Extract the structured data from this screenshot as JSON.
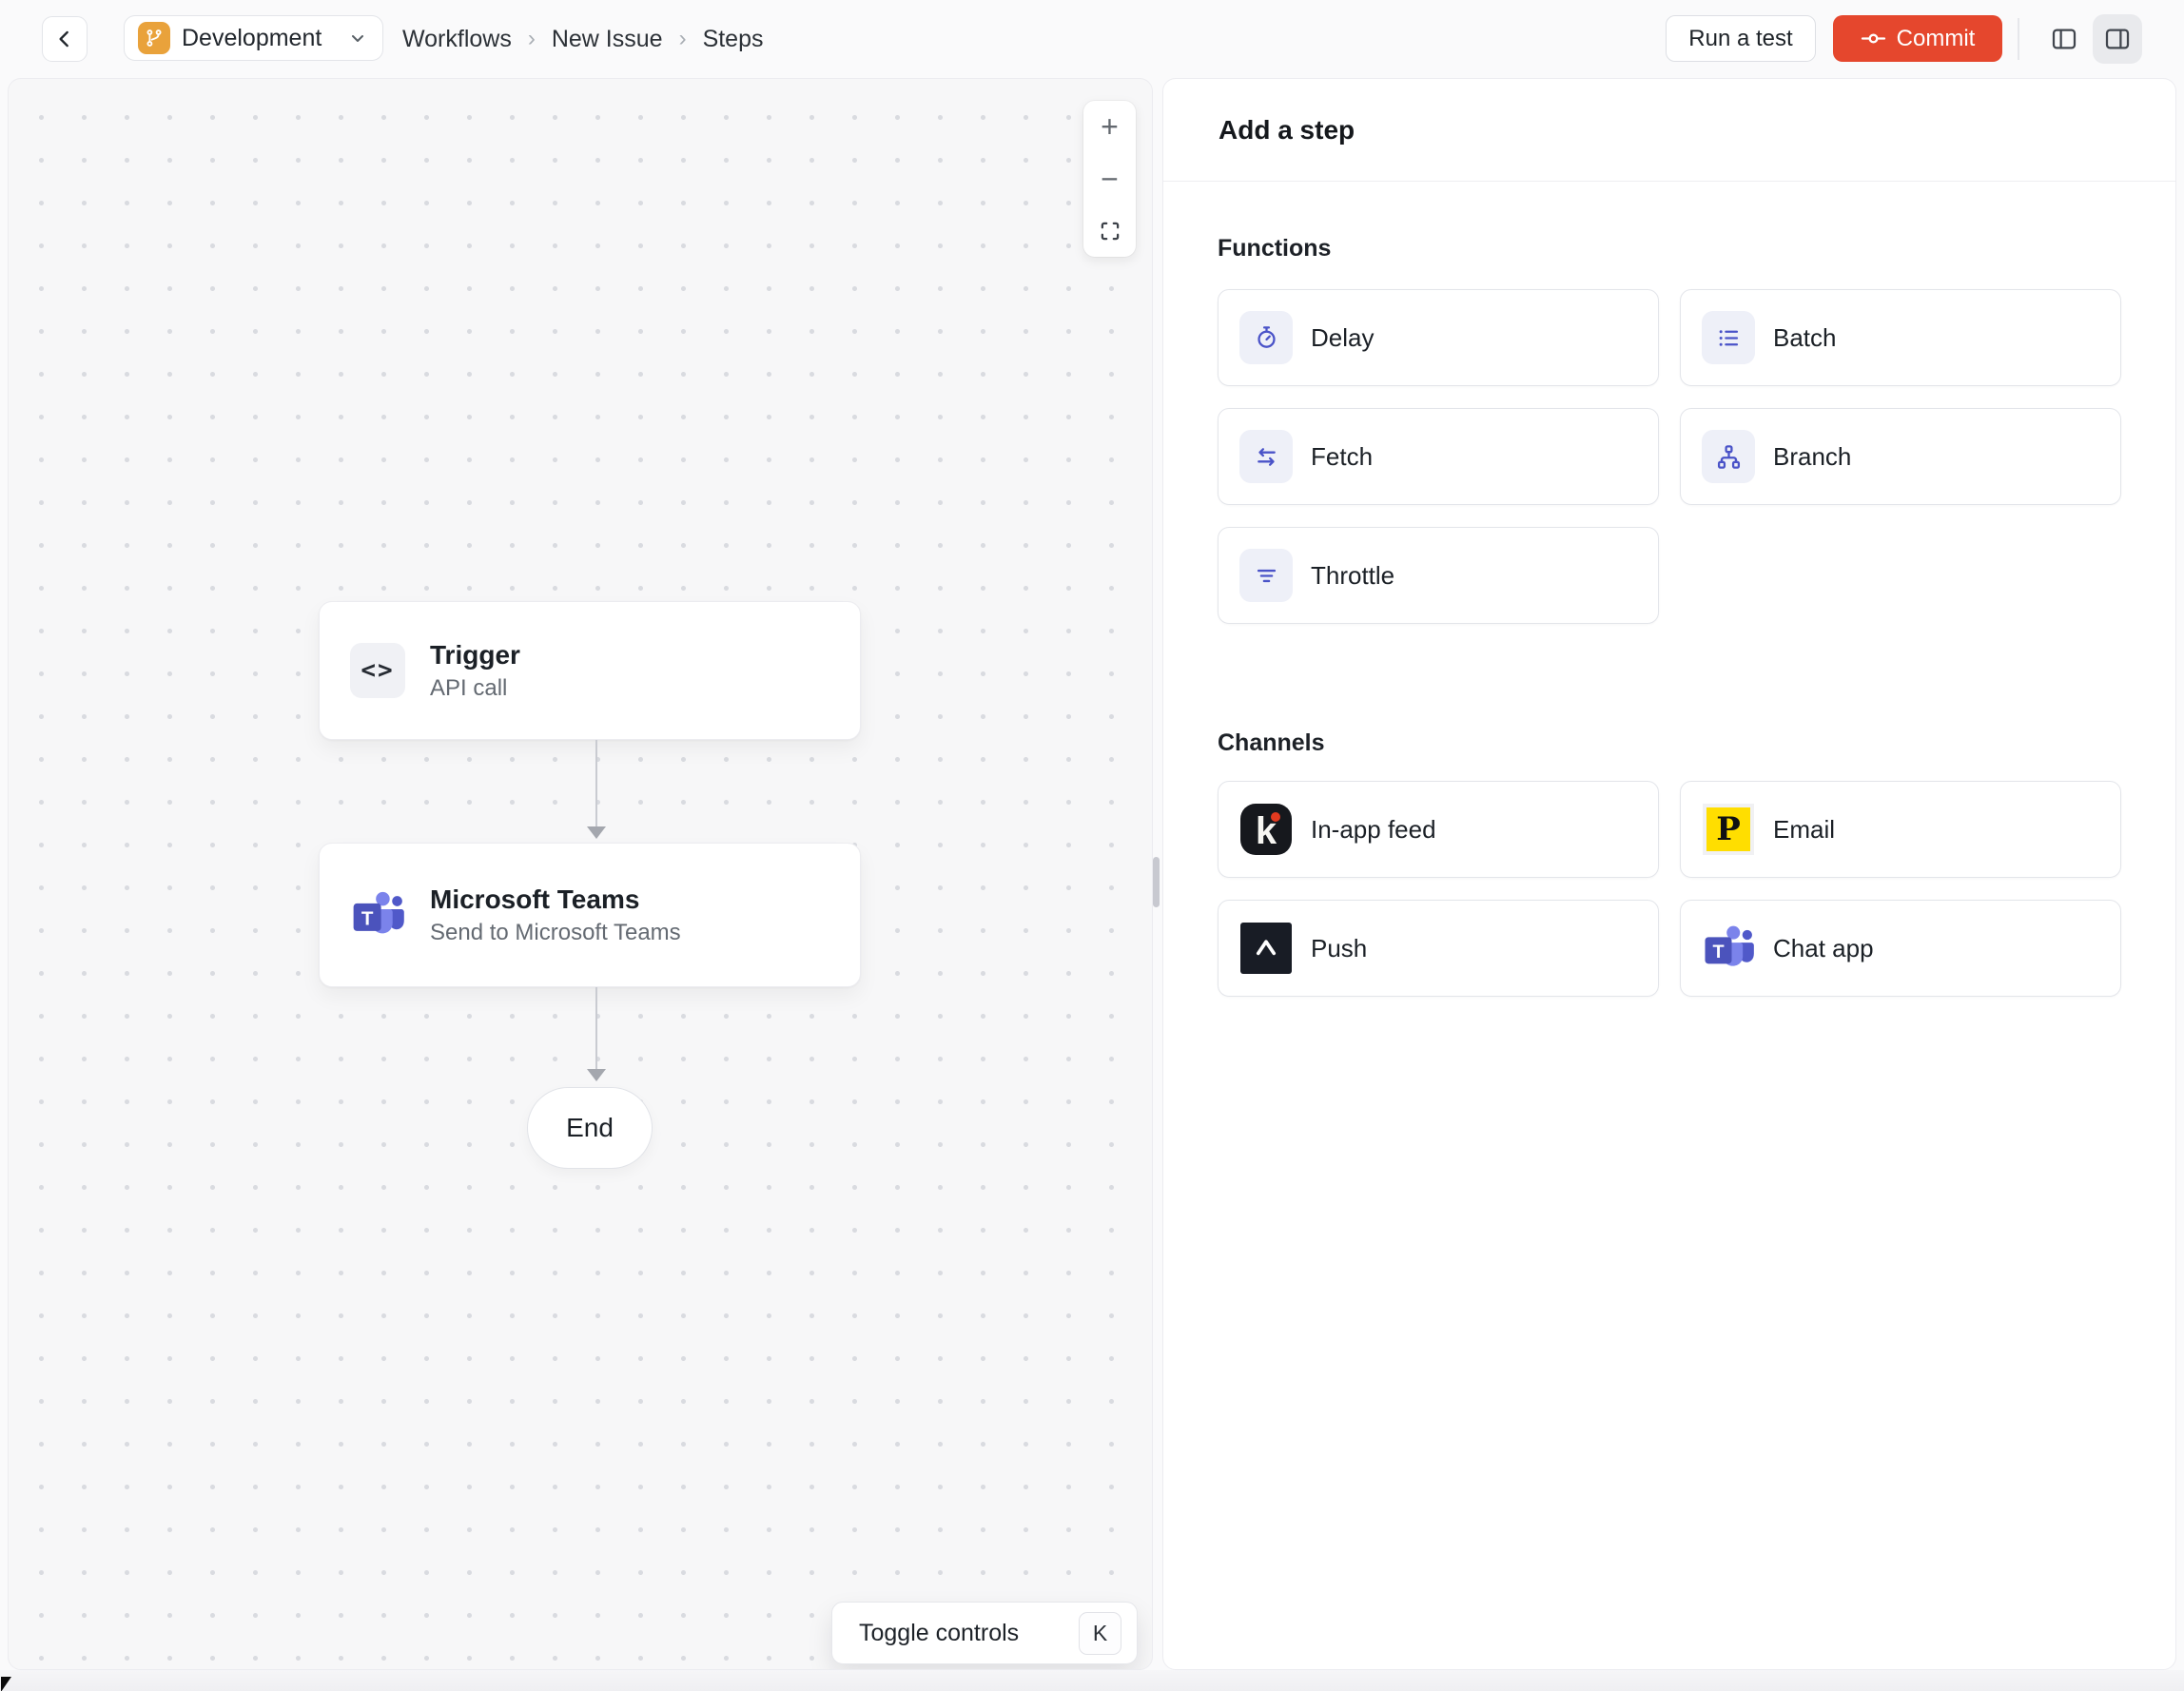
{
  "topbar": {
    "environment": "Development",
    "breadcrumb": [
      "Workflows",
      "New Issue",
      "Steps"
    ],
    "separator": "›",
    "run_test": "Run a test",
    "commit": "Commit"
  },
  "canvas": {
    "controls": {
      "zoom_in": "+",
      "zoom_out": "−"
    },
    "trigger": {
      "title": "Trigger",
      "subtitle": "API call"
    },
    "teams": {
      "title": "Microsoft Teams",
      "subtitle": "Send to Microsoft Teams"
    },
    "end": "End",
    "toggle_controls": "Toggle controls",
    "toggle_shortcut": "K"
  },
  "panel": {
    "title": "Add a step",
    "functions_label": "Functions",
    "channels_label": "Channels",
    "functions": [
      {
        "label": "Delay",
        "icon": "delay-stopwatch-icon"
      },
      {
        "label": "Batch",
        "icon": "batch-list-icon"
      },
      {
        "label": "Fetch",
        "icon": "fetch-arrows-icon"
      },
      {
        "label": "Branch",
        "icon": "branch-hierarchy-icon"
      },
      {
        "label": "Throttle",
        "icon": "throttle-funnel-icon"
      }
    ],
    "channels": [
      {
        "label": "In-app feed",
        "icon": "knock-feed-icon"
      },
      {
        "label": "Email",
        "icon": "postmark-email-icon"
      },
      {
        "label": "Push",
        "icon": "push-provider-icon"
      },
      {
        "label": "Chat app",
        "icon": "ms-teams-icon"
      }
    ]
  },
  "glyphs": {
    "code": "<>",
    "teams_t": "T",
    "knock_k": "k",
    "postmark_p": "P"
  },
  "colors": {
    "commit_button": "#E5472D",
    "environment_badge": "#E9A23B",
    "function_icon_indigo": "#4A53C8",
    "knock_black": "#16181D",
    "postmark_yellow": "#FFDE00",
    "push_black": "#181C25",
    "teams_purple": "#4B53BC",
    "canvas_background": "#F7F7F8"
  }
}
